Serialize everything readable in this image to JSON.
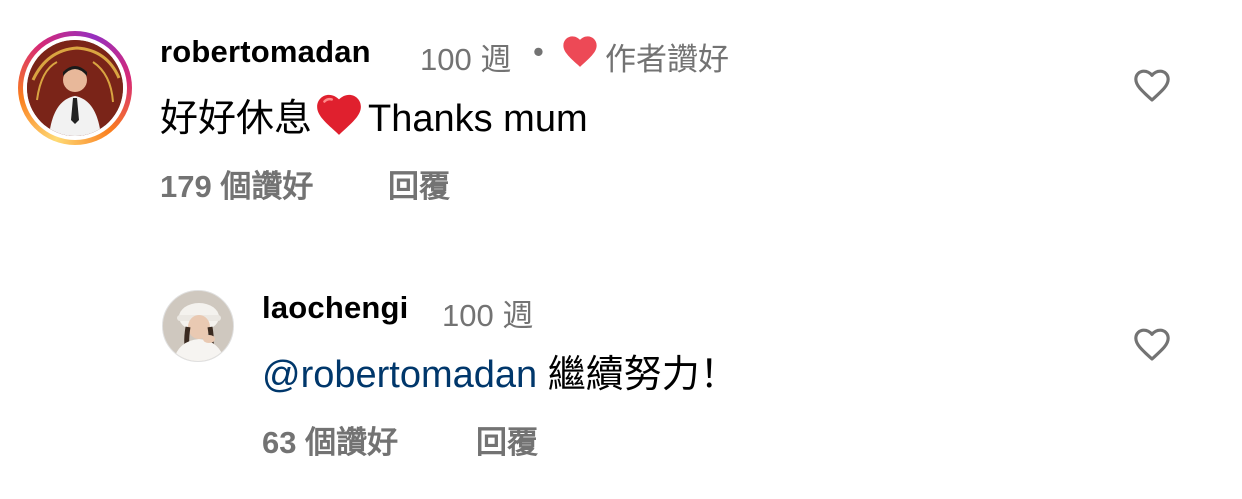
{
  "comment": {
    "username": "robertomadan",
    "time": "100 週",
    "separator": "•",
    "author_liked_label": "作者讚好",
    "text_before": "好好休息",
    "text_after": "Thanks mum",
    "likes": "179 個讚好",
    "reply_label": "回覆"
  },
  "reply": {
    "username": "laochengi",
    "time": "100 週",
    "mention": "@robertomadan",
    "text": " 繼續努力！",
    "likes": "63 個讚好",
    "reply_label": "回覆"
  },
  "colors": {
    "heart_red": "#ed4956",
    "secondary_text": "#737373",
    "mention_blue": "#00376b"
  },
  "icons": {
    "author_like": "heart-filled-icon",
    "like_button": "heart-outline-icon",
    "emoji": "red-heart-emoji"
  }
}
